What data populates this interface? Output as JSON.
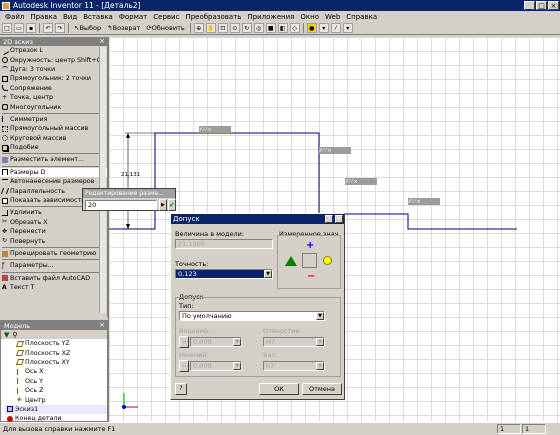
{
  "window": {
    "title": "Autodesk Inventor 11 - [Деталь2]",
    "min": "_",
    "max": "□",
    "close": "×"
  },
  "menu": [
    "Файл",
    "Правка",
    "Вид",
    "Вставка",
    "Формат",
    "Сервис",
    "Преобразовать",
    "Приложения",
    "Окно",
    "Web",
    "Справка"
  ],
  "toolbar": {
    "select_label": "Выбор",
    "back_label": "Возврат",
    "update_label": "Обновить"
  },
  "sketch_panel": {
    "title": "2D эскиз",
    "items": [
      {
        "label": "Отрезок   L",
        "icon": "line-icon"
      },
      {
        "label": "Окружность: центр   Shift+C",
        "icon": "circle-icon"
      },
      {
        "label": "Дуга: 3 точки",
        "icon": "arc-icon"
      },
      {
        "label": "Прямоугольник: 2 точки",
        "icon": "rectangle-icon"
      },
      {
        "label": "Сопряжение",
        "icon": "fillet-icon"
      },
      {
        "label": "Точка, центр",
        "icon": "point-icon"
      },
      {
        "label": "Многоугольник",
        "icon": "polygon-icon"
      },
      {
        "label": "Симметрия",
        "icon": "mirror-icon"
      },
      {
        "label": "Прямоугольный массив",
        "icon": "rect-array-icon"
      },
      {
        "label": "Круговой массив",
        "icon": "circular-array-icon"
      },
      {
        "label": "Подобие",
        "icon": "offset-icon"
      },
      {
        "label": "Разместить элемент...",
        "icon": "place-feature-icon"
      },
      {
        "label": "Размеры   D",
        "icon": "dimension-icon"
      },
      {
        "label": "Автонанесение размеров",
        "icon": "auto-dimension-icon"
      },
      {
        "label": "Параллельность",
        "icon": "parallel-icon"
      },
      {
        "label": "Показать зависимости",
        "icon": "show-constraints-icon"
      },
      {
        "label": "Удлинить",
        "icon": "extend-icon"
      },
      {
        "label": "Обрезать   X",
        "icon": "trim-icon"
      },
      {
        "label": "Перенести",
        "icon": "move-icon"
      },
      {
        "label": "Повернуть",
        "icon": "rotate-icon"
      },
      {
        "label": "Проецировать геометрию",
        "icon": "project-geometry-icon"
      },
      {
        "label": "Параметры...",
        "icon": "parameters-icon"
      },
      {
        "label": "Вставить файл AutoCAD",
        "icon": "insert-autocad-icon"
      },
      {
        "label": "Текст   T",
        "icon": "text-icon"
      }
    ]
  },
  "model_panel": {
    "title": "Модель",
    "items": [
      "Плоскость YZ",
      "Плоскость XZ",
      "Плоскость XY",
      "Ось X",
      "Ось Y",
      "Ось Z",
      "Центр",
      "Эскиз1",
      "Конец детали"
    ]
  },
  "edit_dimension": {
    "title": "Редактирование разме...",
    "value": "20"
  },
  "sketch_dim_label": "21,131",
  "dialog": {
    "title": "Допуск",
    "model_value_label": "Величина в модели:",
    "model_value": "21,1309",
    "precision_label": "Точность:",
    "precision_value": "0,123",
    "measured_label": "Измеренное знач.",
    "tolerance_group": "Допуск",
    "type_label": "Тип:",
    "type_value": "По умолчанию",
    "upper_label": "Верхний:",
    "upper_value": "0,000",
    "lower_label": "Нижний:",
    "lower_value": "0,000",
    "hole_label": "Отверстие:",
    "hole_value": "H7",
    "shaft_label": "Вал:",
    "shaft_value": "h7",
    "ok_label": "ОК",
    "cancel_label": "Отмена"
  },
  "status": {
    "text": "Для вызова справки нажмите F1",
    "cell1": "1",
    "cell2": "1"
  },
  "colors": {
    "title_bg": "#0a246a",
    "sketch_line": "#000080",
    "triangle": "#008000",
    "circle": "#ffff00",
    "plus": "#0000ff",
    "minus": "#ff0000"
  }
}
